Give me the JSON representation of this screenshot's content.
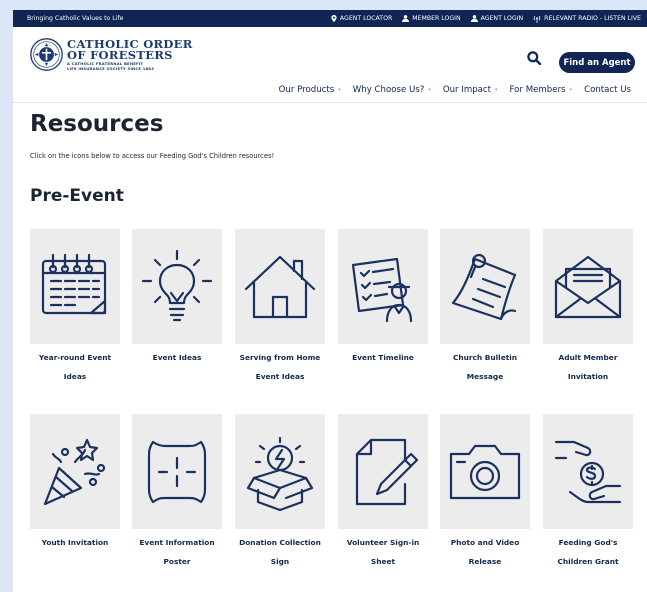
{
  "topbar": {
    "tagline": "Bringing Catholic Values to Life",
    "links": [
      {
        "label": "AGENT LOCATOR",
        "icon": "location-pin-icon"
      },
      {
        "label": "MEMBER LOGIN",
        "icon": "user-icon"
      },
      {
        "label": "AGENT LOGIN",
        "icon": "user-icon"
      },
      {
        "label": "RELEVANT RADIO - LISTEN LIVE",
        "icon": "radio-icon"
      }
    ]
  },
  "header": {
    "logo_line1": "CATHOLIC ORDER",
    "logo_line2": "OF FORESTERS",
    "logo_sub1": "A CATHOLIC FRATERNAL BENEFIT",
    "logo_sub2": "LIFE INSURANCE SOCIETY SINCE 1883",
    "find_agent": "Find an Agent",
    "nav": [
      "Our Products",
      "Why Choose Us?",
      "Our Impact",
      "For Members",
      "Contact Us"
    ]
  },
  "main": {
    "title": "Resources",
    "intro": "Click on the icons below to access our Feeding God's Children resources!",
    "section_title": "Pre-Event",
    "row1": [
      {
        "label": "Year-round Event Ideas",
        "icon": "calendar-icon"
      },
      {
        "label": "Event Ideas",
        "icon": "lightbulb-icon"
      },
      {
        "label": "Serving from Home Event Ideas",
        "icon": "house-icon"
      },
      {
        "label": "Event Timeline",
        "icon": "checklist-icon"
      },
      {
        "label": "Church Bulletin Message",
        "icon": "pinned-note-icon"
      },
      {
        "label": "Adult Member Invitation",
        "icon": "envelope-icon"
      }
    ],
    "row2": [
      {
        "label": "Youth Invitation",
        "icon": "party-popper-icon"
      },
      {
        "label": "Event Information Poster",
        "icon": "poster-icon"
      },
      {
        "label": "Donation Collection Sign",
        "icon": "idea-box-icon"
      },
      {
        "label": "Volunteer Sign-in Sheet",
        "icon": "document-pencil-icon"
      },
      {
        "label": "Photo and Video Release",
        "icon": "camera-icon"
      },
      {
        "label": "Feeding God's Children Grant",
        "icon": "hand-coin-icon"
      }
    ]
  },
  "colors": {
    "navy": "#0f2553",
    "icon": "#1b3160",
    "tile": "#ececec",
    "frame": "#dbe7f7"
  }
}
